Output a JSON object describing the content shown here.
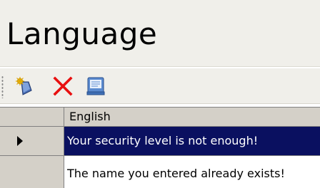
{
  "title": "Language",
  "toolbar": {
    "buttons": [
      {
        "name": "add-record-button",
        "icon": "new-record-icon"
      },
      {
        "name": "delete-button",
        "icon": "delete-x-icon"
      },
      {
        "name": "save-button",
        "icon": "save-form-icon"
      }
    ]
  },
  "grid": {
    "columns": [
      "English"
    ],
    "rows": [
      {
        "english": "Your security level is not enough!",
        "selected": true
      },
      {
        "english": "The name you entered already exists!",
        "selected": false
      }
    ]
  },
  "colors": {
    "selection": "#0a1060",
    "delete_icon": "#e81010",
    "header_bg": "#d4d0c8",
    "title_bg": "#f0efea"
  }
}
